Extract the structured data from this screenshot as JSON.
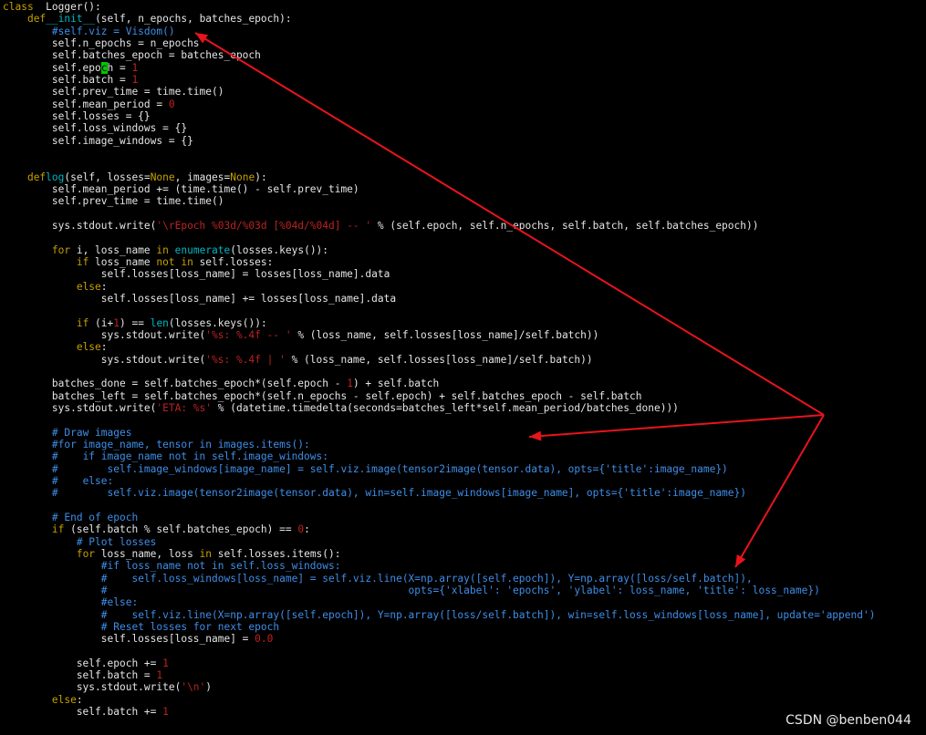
{
  "editor": {
    "lines": [
      [
        [
          "kw",
          "class"
        ],
        [
          "",
          "  Logger():"
        ]
      ],
      [
        [
          "",
          "    "
        ],
        [
          "kw",
          "def"
        ],
        [
          "",
          ""
        ],
        [
          "bi",
          "__init__"
        ],
        [
          "",
          "(self, n_epochs, batches_epoch):"
        ]
      ],
      [
        [
          "",
          "        "
        ],
        [
          "cm",
          "#self.viz = Visdom()"
        ]
      ],
      [
        [
          "",
          "        self.n_epochs = n_epochs"
        ]
      ],
      [
        [
          "",
          "        self.batches_epoch = batches_epoch"
        ]
      ],
      [
        [
          "",
          "        self.epo"
        ],
        [
          "cursor",
          "c"
        ],
        [
          "",
          "h = "
        ],
        [
          "nm",
          "1"
        ]
      ],
      [
        [
          "",
          "        self.batch = "
        ],
        [
          "nm",
          "1"
        ]
      ],
      [
        [
          "",
          "        self.prev_time = time.time()"
        ]
      ],
      [
        [
          "",
          "        self.mean_period = "
        ],
        [
          "nm",
          "0"
        ]
      ],
      [
        [
          "",
          "        self.losses = {}"
        ]
      ],
      [
        [
          "",
          "        self.loss_windows = {}"
        ]
      ],
      [
        [
          "",
          "        self.image_windows = {}"
        ]
      ],
      [],
      [],
      [
        [
          "",
          "    "
        ],
        [
          "kw",
          "def"
        ],
        [
          "",
          ""
        ],
        [
          "bi",
          "log"
        ],
        [
          "",
          "(self, losses="
        ],
        [
          "kw",
          "None"
        ],
        [
          "",
          ", images="
        ],
        [
          "kw",
          "None"
        ],
        [
          "",
          "):"
        ]
      ],
      [
        [
          "",
          "        self.mean_period += (time.time() - self.prev_time)"
        ]
      ],
      [
        [
          "",
          "        self.prev_time = time.time()"
        ]
      ],
      [],
      [
        [
          "",
          "        sys.stdout.write("
        ],
        [
          "st",
          "'\\rEpoch %03d/%03d [%04d/%04d] -- '"
        ],
        [
          "",
          " % (self.epoch, self.n_epochs, self.batch, self.batches_epoch))"
        ]
      ],
      [],
      [
        [
          "",
          "        "
        ],
        [
          "kw",
          "for"
        ],
        [
          "",
          " i, loss_name "
        ],
        [
          "kw",
          "in"
        ],
        [
          "",
          " "
        ],
        [
          "bi",
          "enumerate"
        ],
        [
          "",
          "(losses.keys()):"
        ]
      ],
      [
        [
          "",
          "            "
        ],
        [
          "kw",
          "if"
        ],
        [
          "",
          " loss_name "
        ],
        [
          "kw",
          "not in"
        ],
        [
          "",
          " self.losses:"
        ]
      ],
      [
        [
          "",
          "                self.losses[loss_name] = losses[loss_name].data"
        ]
      ],
      [
        [
          "",
          "            "
        ],
        [
          "kw",
          "else"
        ],
        [
          "",
          ":"
        ]
      ],
      [
        [
          "",
          "                self.losses[loss_name] += losses[loss_name].data"
        ]
      ],
      [],
      [
        [
          "",
          "            "
        ],
        [
          "kw",
          "if"
        ],
        [
          "",
          " (i+"
        ],
        [
          "nm",
          "1"
        ],
        [
          "",
          ") == "
        ],
        [
          "bi",
          "len"
        ],
        [
          "",
          "(losses.keys()):"
        ]
      ],
      [
        [
          "",
          "                sys.stdout.write("
        ],
        [
          "st",
          "'%s: %.4f -- '"
        ],
        [
          "",
          " % (loss_name, self.losses[loss_name]/self.batch))"
        ]
      ],
      [
        [
          "",
          "            "
        ],
        [
          "kw",
          "else"
        ],
        [
          "",
          ":"
        ]
      ],
      [
        [
          "",
          "                sys.stdout.write("
        ],
        [
          "st",
          "'%s: %.4f | '"
        ],
        [
          "",
          " % (loss_name, self.losses[loss_name]/self.batch))"
        ]
      ],
      [],
      [
        [
          "",
          "        batches_done = self.batches_epoch*(self.epoch - "
        ],
        [
          "nm",
          "1"
        ],
        [
          "",
          ") + self.batch"
        ]
      ],
      [
        [
          "",
          "        batches_left = self.batches_epoch*(self.n_epochs - self.epoch) + self.batches_epoch - self.batch"
        ]
      ],
      [
        [
          "",
          "        sys.stdout.write("
        ],
        [
          "st",
          "'ETA: %s'"
        ],
        [
          "",
          " % (datetime.timedelta(seconds=batches_left*self.mean_period/batches_done)))"
        ]
      ],
      [],
      [
        [
          "",
          "        "
        ],
        [
          "cm",
          "# Draw images"
        ]
      ],
      [
        [
          "",
          "        "
        ],
        [
          "cm",
          "#for image_name, tensor in images.items():"
        ]
      ],
      [
        [
          "",
          "        "
        ],
        [
          "cm",
          "#    if image_name not in self.image_windows:"
        ]
      ],
      [
        [
          "",
          "        "
        ],
        [
          "cm",
          "#        self.image_windows[image_name] = self.viz.image(tensor2image(tensor.data), opts={'title':image_name})"
        ]
      ],
      [
        [
          "",
          "        "
        ],
        [
          "cm",
          "#    else:"
        ]
      ],
      [
        [
          "",
          "        "
        ],
        [
          "cm",
          "#        self.viz.image(tensor2image(tensor.data), win=self.image_windows[image_name], opts={'title':image_name})"
        ]
      ],
      [],
      [
        [
          "",
          "        "
        ],
        [
          "cm",
          "# End of epoch"
        ]
      ],
      [
        [
          "",
          "        "
        ],
        [
          "kw",
          "if"
        ],
        [
          "",
          " (self.batch % self.batches_epoch) == "
        ],
        [
          "nm",
          "0"
        ],
        [
          "",
          ":"
        ]
      ],
      [
        [
          "",
          "            "
        ],
        [
          "cm",
          "# Plot losses"
        ]
      ],
      [
        [
          "",
          "            "
        ],
        [
          "kw",
          "for"
        ],
        [
          "",
          " loss_name, loss "
        ],
        [
          "kw",
          "in"
        ],
        [
          "",
          " self.losses.items():"
        ]
      ],
      [
        [
          "",
          "                "
        ],
        [
          "cm",
          "#if loss_name not in self.loss_windows:"
        ]
      ],
      [
        [
          "",
          "                "
        ],
        [
          "cm",
          "#    self.loss_windows[loss_name] = self.viz.line(X=np.array([self.epoch]), Y=np.array([loss/self.batch]),"
        ]
      ],
      [
        [
          "",
          "                "
        ],
        [
          "cm",
          "#                                                 opts={'xlabel': 'epochs', 'ylabel': loss_name, 'title': loss_name})"
        ]
      ],
      [
        [
          "",
          "                "
        ],
        [
          "cm",
          "#else:"
        ]
      ],
      [
        [
          "",
          "                "
        ],
        [
          "cm",
          "#    self.viz.line(X=np.array([self.epoch]), Y=np.array([loss/self.batch]), win=self.loss_windows[loss_name], update='append')"
        ]
      ],
      [
        [
          "",
          "                "
        ],
        [
          "cm",
          "# Reset losses for next epoch"
        ]
      ],
      [
        [
          "",
          "                self.losses[loss_name] = "
        ],
        [
          "nm",
          "0.0"
        ]
      ],
      [],
      [
        [
          "",
          "            self.epoch += "
        ],
        [
          "nm",
          "1"
        ]
      ],
      [
        [
          "",
          "            self.batch = "
        ],
        [
          "nm",
          "1"
        ]
      ],
      [
        [
          "",
          "            sys.stdout.write("
        ],
        [
          "st",
          "'\\n'"
        ],
        [
          "",
          ")"
        ]
      ],
      [
        [
          "",
          "        "
        ],
        [
          "kw",
          "else"
        ],
        [
          "",
          ":"
        ]
      ],
      [
        [
          "",
          "            self.batch += "
        ],
        [
          "nm",
          "1"
        ]
      ]
    ]
  },
  "annotations": {
    "arrow_color": "#e8141c"
  },
  "watermark": {
    "text": "CSDN @benben044"
  }
}
